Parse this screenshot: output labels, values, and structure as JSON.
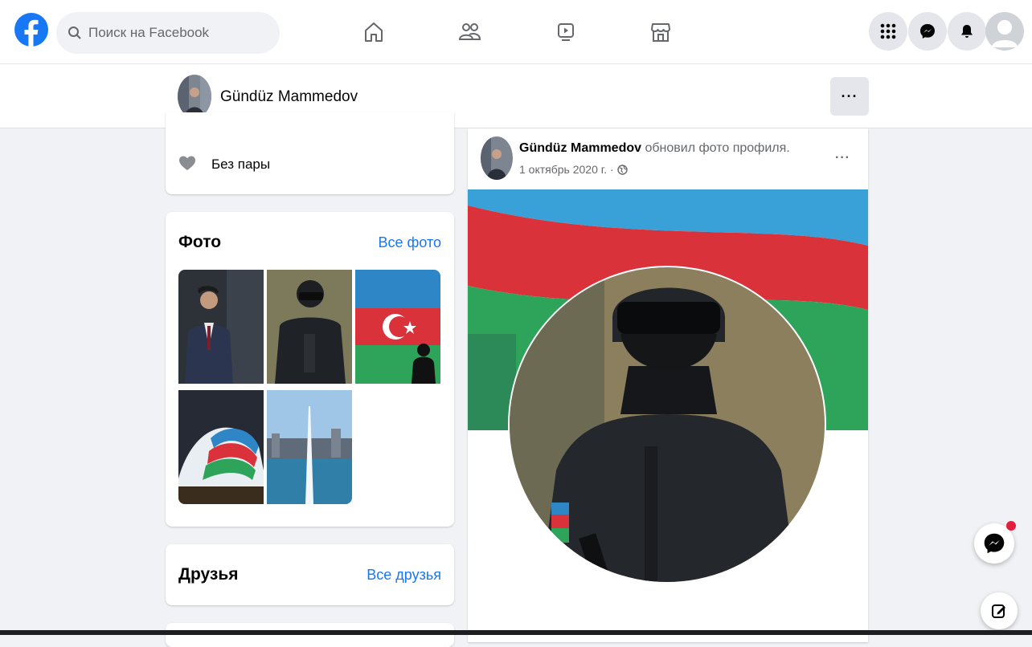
{
  "search": {
    "placeholder": "Поиск на Facebook"
  },
  "nav": {
    "icons": [
      "home-icon",
      "friends-icon",
      "watch-icon",
      "marketplace-icon"
    ],
    "right_icons": [
      "menu-grid-icon",
      "messenger-icon",
      "notifications-icon",
      "account-avatar"
    ]
  },
  "profile_bar": {
    "name": "Gündüz Mammedov",
    "more_label": "···"
  },
  "relationship": {
    "label": "Без пары"
  },
  "photos": {
    "title": "Фото",
    "link": "Все фото"
  },
  "friends": {
    "title": "Друзья",
    "link": "Все друзья"
  },
  "post": {
    "author": "Gündüz Mammedov",
    "action": "обновил фото профиля.",
    "date": "1 октябрь 2020 г. ·",
    "more_label": "···"
  },
  "colors": {
    "brand": "#1877f2",
    "background": "#f0f2f5",
    "notification": "#e41e3f"
  }
}
